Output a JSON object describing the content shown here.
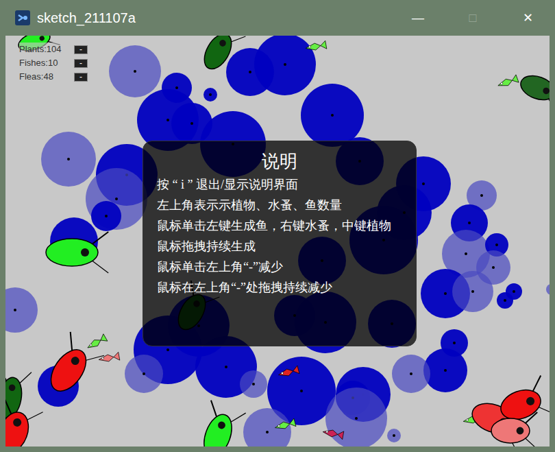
{
  "window": {
    "title": "sketch_211107a",
    "controls": [
      {
        "label": "—",
        "disabled": false
      },
      {
        "label": "□",
        "disabled": true
      },
      {
        "label": "✕",
        "disabled": false
      }
    ]
  },
  "counters": [
    {
      "label": "Plants:104",
      "button": "-"
    },
    {
      "label": "Fishes:10",
      "button": "-"
    },
    {
      "label": "Fleas:48",
      "button": "-"
    }
  ],
  "help": {
    "title": "说明",
    "lines": [
      "按 “ i ” 退出/显示说明界面",
      "左上角表示示植物、水蚤、鱼数量",
      "鼠标单击左键生成鱼，右键水蚤，中键植物",
      "鼠标拖拽持续生成",
      "鼠标单击左上角“-”减少",
      "鼠标在左上角“-”处拖拽持续减少"
    ]
  }
}
